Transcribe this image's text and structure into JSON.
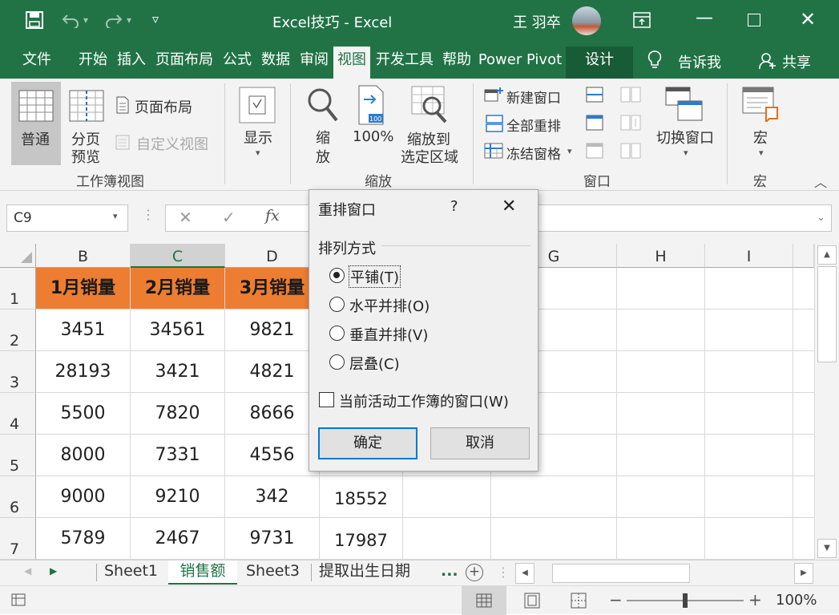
{
  "window": {
    "doc_title": "Excel技巧  -  Excel",
    "user": "王 羽卒"
  },
  "tabs": [
    "文件",
    "开始",
    "插入",
    "页面布局",
    "公式",
    "数据",
    "审阅",
    "视图",
    "开发工具",
    "帮助",
    "Power Pivot",
    "设计"
  ],
  "tellme": "告诉我",
  "share": "共享",
  "ribbon": {
    "normal": "普通",
    "page_break_preview": [
      "分页",
      "预览"
    ],
    "page_layout": "页面布局",
    "custom_views": "自定义视图",
    "workbook_views_group": "工作簿视图",
    "show": "显示",
    "zoom": [
      "缩",
      "放"
    ],
    "zoom100": "100%",
    "zoom_selection": [
      "缩放到",
      "选定区域"
    ],
    "zoom_group": "缩放",
    "new_window": "新建窗口",
    "arrange_all": "全部重排",
    "freeze_panes": "冻结窗格",
    "switch_windows": "切换窗口",
    "window_group": "窗口",
    "macros": "宏",
    "macros_group": "宏"
  },
  "formula": {
    "name_box": "C9",
    "fx": "fx"
  },
  "grid": {
    "columns": [
      "B",
      "C",
      "D",
      "G",
      "H",
      "I"
    ],
    "rows": [
      "1",
      "2",
      "3",
      "4",
      "5",
      "6",
      "7"
    ],
    "headers": [
      "1月销量",
      "2月销量",
      "3月销量"
    ],
    "data": [
      [
        "3451",
        "34561",
        "9821"
      ],
      [
        "28193",
        "3421",
        "4821"
      ],
      [
        "5500",
        "7820",
        "8666"
      ],
      [
        "8000",
        "7331",
        "4556"
      ],
      [
        "9000",
        "9210",
        "342"
      ],
      [
        "5789",
        "2467",
        "9731"
      ]
    ],
    "e_col": [
      "",
      "",
      "",
      "",
      "18552",
      "17987"
    ]
  },
  "sheets": [
    "Sheet1",
    "销售额",
    "Sheet3",
    "提取出生日期"
  ],
  "sheets_more": "...",
  "status": {
    "zoom": "100%"
  },
  "dialog": {
    "title": "重排窗口",
    "help": "?",
    "section": "排列方式",
    "options": [
      "平铺(T)",
      "水平并排(O)",
      "垂直并排(V)",
      "层叠(C)"
    ],
    "selected_option": "平铺(T)",
    "checkbox": "当前活动工作簿的窗口(W)",
    "checkbox_checked": false,
    "ok": "确定",
    "cancel": "取消"
  },
  "colors": {
    "excel_green": "#217346",
    "header_fill": "#ed7d31",
    "accent": "#0078d7"
  }
}
